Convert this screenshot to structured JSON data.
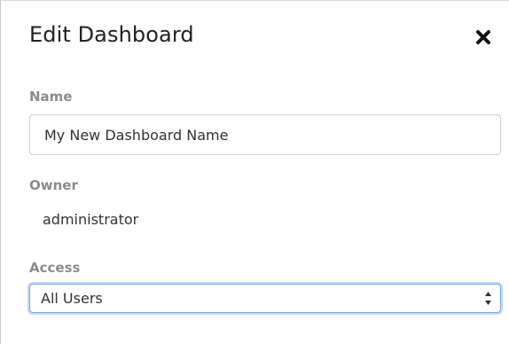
{
  "dialog": {
    "title": "Edit Dashboard",
    "close_icon": "close-icon"
  },
  "form": {
    "name_label": "Name",
    "name_value": "My New Dashboard Name",
    "owner_label": "Owner",
    "owner_value": "administrator",
    "access_label": "Access",
    "access_selected": "All Users"
  }
}
